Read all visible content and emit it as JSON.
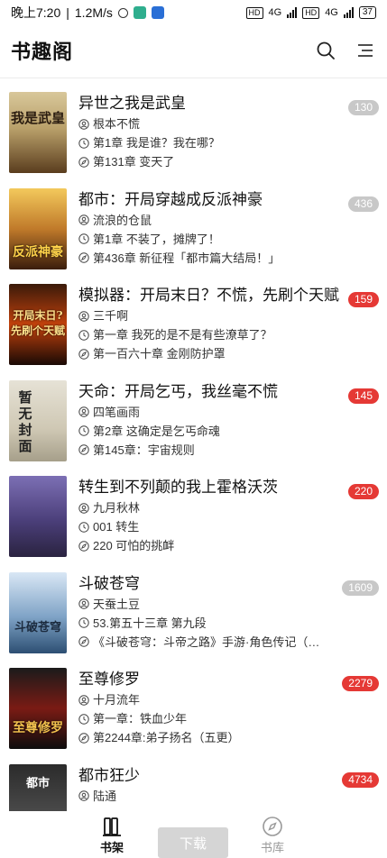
{
  "status_bar": {
    "time": "晚上7:20",
    "speed": "1.2M/s",
    "net1": "4G",
    "net2": "4G",
    "hd1": "HD",
    "hd2": "HD",
    "battery": "37"
  },
  "header": {
    "title": "书趣阁",
    "search_icon": "search-icon",
    "menu_icon": "list-menu-icon"
  },
  "colors": {
    "badge_red": "#e53935",
    "badge_gray": "#c8c8c8"
  },
  "books": [
    {
      "title": "异世之我是武皇",
      "author": "根本不慌",
      "first_chapter": "第1章 我是谁？我在哪？",
      "latest_chapter": "第131章 变天了",
      "unread": "130",
      "badge_style": "gray",
      "cover_text": "我是武皇"
    },
    {
      "title": "都市：开局穿越成反派神豪",
      "author": "流浪的仓鼠",
      "first_chapter": "第1章 不装了，摊牌了！",
      "latest_chapter": "第436章 新征程「都市篇大结局！」",
      "unread": "436",
      "badge_style": "gray",
      "cover_text": "反派神豪"
    },
    {
      "title": "模拟器：开局末日？不慌，先刷个天赋",
      "author": "三千啊",
      "first_chapter": "第一章 我死的是不是有些潦草了？",
      "latest_chapter": "第一百六十章 金刚防护罩",
      "unread": "159",
      "badge_style": "red",
      "cover_text": "开局末日?先刷个天赋"
    },
    {
      "title": "天命：开局乞丐，我丝毫不慌",
      "author": "四笔画雨",
      "first_chapter": "第2章 这确定是乞丐命魂",
      "latest_chapter": "第145章：宇宙规则",
      "unread": "145",
      "badge_style": "red",
      "cover_text": "暂无封面"
    },
    {
      "title": "转生到不列颠的我上霍格沃茨",
      "author": "九月秋林",
      "first_chapter": "001 转生",
      "latest_chapter": "220 可怕的挑衅",
      "unread": "220",
      "badge_style": "red",
      "cover_text": ""
    },
    {
      "title": "斗破苍穹",
      "author": "天蚕土豆",
      "first_chapter": "53.第五十三章 第九段",
      "latest_chapter": "《斗破苍穹：斗帝之路》手游·角色传记（…",
      "unread": "1609",
      "badge_style": "gray",
      "cover_text": "斗破苍穹"
    },
    {
      "title": "至尊修罗",
      "author": "十月流年",
      "first_chapter": "第一章：铁血少年",
      "latest_chapter": "第2244章:弟子扬名（五更）",
      "unread": "2279",
      "badge_style": "red",
      "cover_text": "至尊修罗"
    },
    {
      "title": "都市狂少",
      "author": "陆通",
      "first_chapter": "",
      "latest_chapter": "",
      "unread": "4734",
      "badge_style": "red",
      "cover_text": "都市"
    }
  ],
  "bottom_nav": {
    "shelf_label": "书架",
    "download_label": "下载",
    "store_label": "书库"
  }
}
